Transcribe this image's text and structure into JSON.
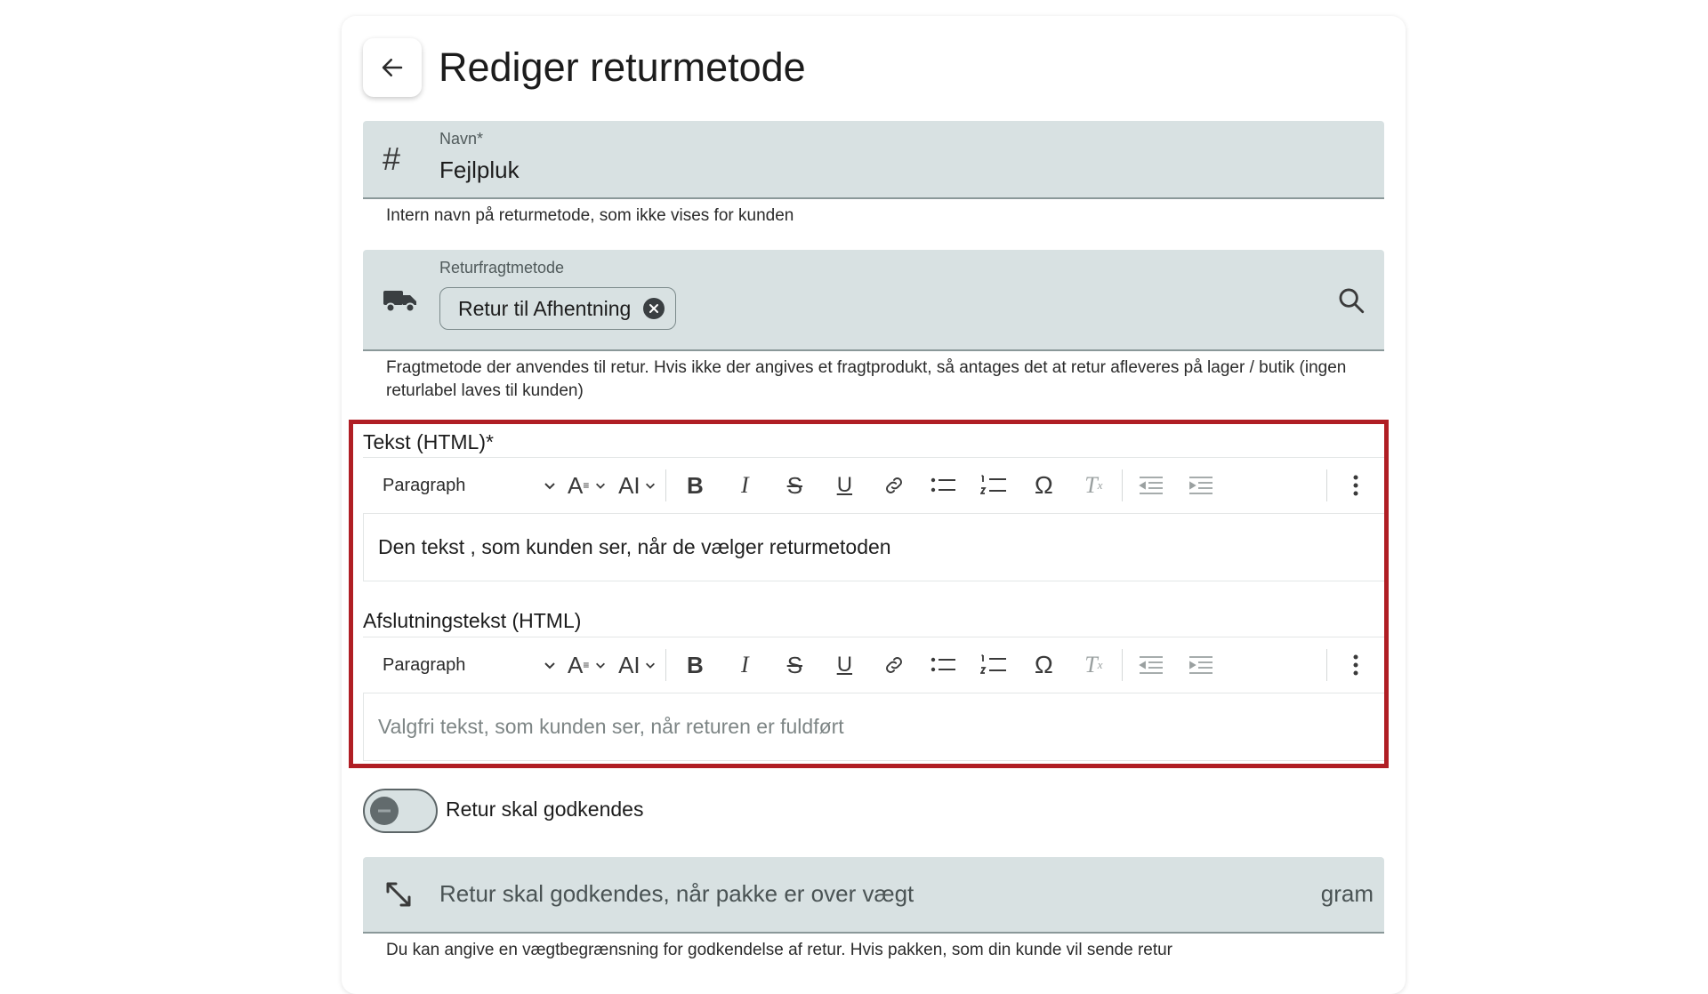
{
  "page": {
    "title": "Rediger returmetode"
  },
  "name_field": {
    "label": "Navn*",
    "value": "Fejlpluk",
    "icon": "hash-icon",
    "hint": "Intern navn på returmetode, som ikke vises for kunden"
  },
  "shipping_field": {
    "label": "Returfragtmetode",
    "icon": "truck-icon",
    "chip": "Retur til Afhentning",
    "hint": "Fragtmetode der anvendes til retur. Hvis ikke der angives et fragtprodukt, så antages det at retur afleveres på lager / butik (ingen returlabel laves til kunden)"
  },
  "text_editor": {
    "label": "Tekst (HTML)*",
    "format_select": "Paragraph",
    "content": "Den tekst , som kunden ser, når de vælger returmetoden"
  },
  "closing_editor": {
    "label": "Afslutningstekst (HTML)",
    "format_select": "Paragraph",
    "placeholder": "Valgfri tekst, som kunden ser, når returen er fuldført"
  },
  "toolbar_icons": [
    "font-size-icon",
    "ai-icon",
    "bold-icon",
    "italic-icon",
    "strikethrough-icon",
    "underline-icon",
    "link-icon",
    "bullet-list-icon",
    "numbered-list-icon",
    "omega-icon",
    "clear-format-icon",
    "outdent-icon",
    "indent-icon",
    "more-vertical-icon"
  ],
  "approval_toggle": {
    "label": "Retur skal godkendes",
    "on": false
  },
  "weight_field": {
    "placeholder": "Retur skal godkendes, når pakke er over vægt",
    "suffix": "gram",
    "icon": "resize-arrow-icon",
    "hint": "Du kan angive en vægtbegrænsning for godkendelse af retur. Hvis pakken, som din kunde vil sende retur"
  },
  "colors": {
    "field_bg": "#d8e1e2",
    "highlight": "#b01e24"
  }
}
